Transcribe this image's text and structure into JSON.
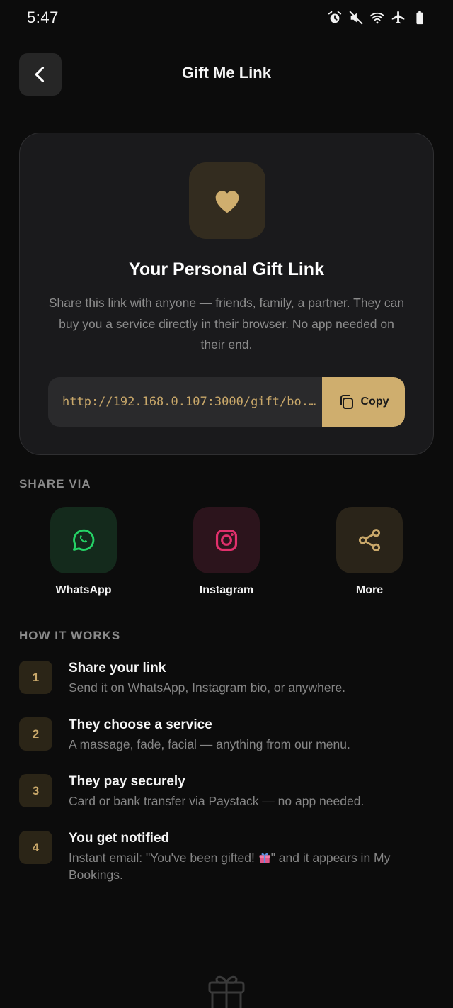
{
  "status_bar": {
    "time": "5:47",
    "icons": [
      "alarm-icon",
      "mute-icon",
      "wifi-icon",
      "airplane-icon",
      "battery-icon"
    ]
  },
  "header": {
    "title": "Gift Me Link",
    "back_icon": "chevron-left-icon"
  },
  "gift_card": {
    "icon": "heart-icon",
    "title": "Your Personal Gift Link",
    "description": "Share this link with anyone — friends, family, a partner. They can buy you a service directly in their browser. No app needed on their end.",
    "link_value": "http://192.168.0.107:3000/gift/bo...",
    "copy_label": "Copy",
    "copy_icon": "copy-icon"
  },
  "share_via": {
    "label": "SHARE VIA",
    "options": [
      {
        "label": "WhatsApp",
        "icon": "whatsapp-icon",
        "color": "#25d366"
      },
      {
        "label": "Instagram",
        "icon": "instagram-icon",
        "color": "#e1306c"
      },
      {
        "label": "More",
        "icon": "share-icon",
        "color": "#c9a86a"
      }
    ]
  },
  "how_it_works": {
    "label": "HOW IT WORKS",
    "steps": [
      {
        "number": "1",
        "title": "Share your link",
        "description": "Send it on WhatsApp, Instagram bio, or anywhere."
      },
      {
        "number": "2",
        "title": "They choose a service",
        "description": "A massage, fade, facial — anything from our menu."
      },
      {
        "number": "3",
        "title": "They pay securely",
        "description": "Card or bank transfer via Paystack — no app needed."
      },
      {
        "number": "4",
        "title": "You get notified",
        "description_before": "Instant email: \"You've been gifted! ",
        "description_after": "\" and it appears in My Bookings."
      }
    ]
  },
  "footer": {
    "icon": "gift-icon"
  },
  "colors": {
    "background": "#0c0c0c",
    "card": "#1a1a1c",
    "accent_gold": "#cfae6e",
    "text_muted": "#8c8c8c"
  }
}
